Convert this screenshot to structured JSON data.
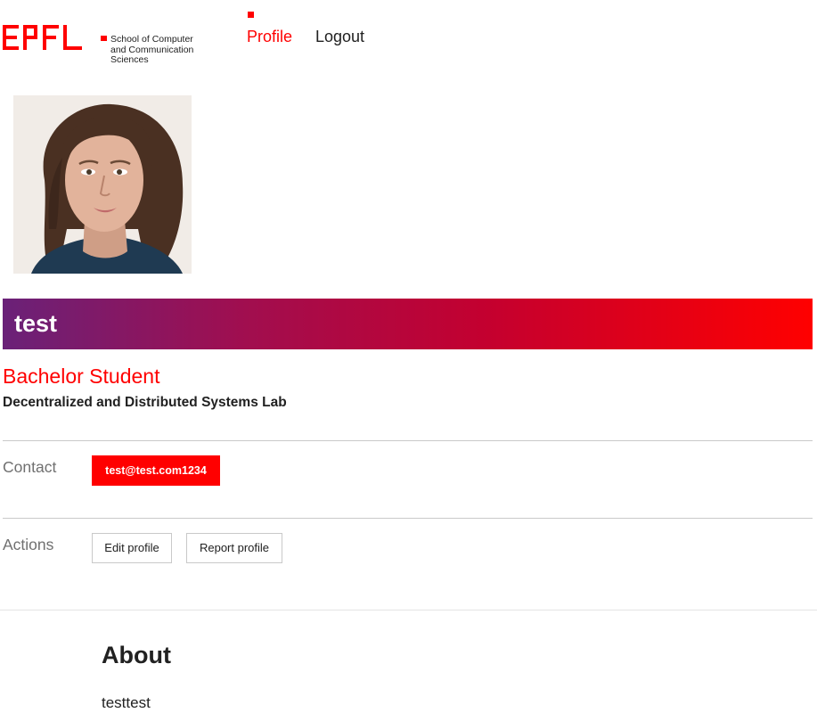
{
  "header": {
    "logo_text": "EPFL",
    "school": "School of Computer and Communication Sciences",
    "nav": {
      "profile": "Profile",
      "logout": "Logout"
    }
  },
  "colors": {
    "accent": "#ff0000",
    "banner_start": "#6a2178",
    "banner_end": "#ff0000",
    "text": "#212121",
    "muted": "#707070"
  },
  "profile": {
    "name": "test",
    "position": "Bachelor Student",
    "unit": "Decentralized and Distributed Systems Lab"
  },
  "contact": {
    "label": "Contact",
    "email": "test@test.com1234"
  },
  "actions": {
    "label": "Actions",
    "edit": "Edit profile",
    "report": "Report profile"
  },
  "about": {
    "heading": "About",
    "text": "testtest"
  }
}
